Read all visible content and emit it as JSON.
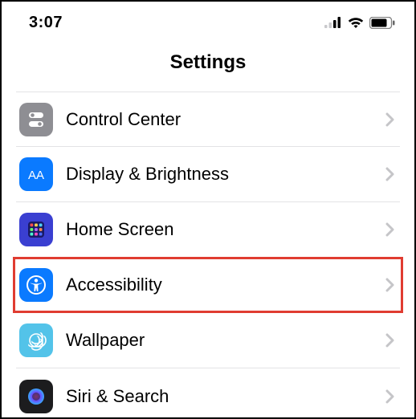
{
  "status": {
    "time": "3:07"
  },
  "header": {
    "title": "Settings"
  },
  "rows": {
    "control_center": "Control Center",
    "display_brightness": "Display & Brightness",
    "home_screen": "Home Screen",
    "accessibility": "Accessibility",
    "wallpaper": "Wallpaper",
    "siri_search": "Siri & Search"
  }
}
